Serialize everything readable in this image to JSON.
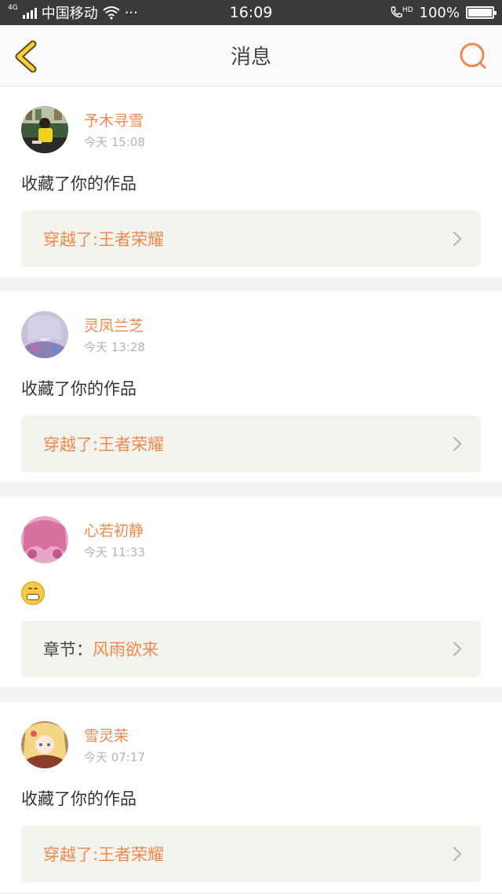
{
  "status_bar": {
    "network_type": "4G",
    "carrier": "中国移动",
    "more": "···",
    "time": "16:09",
    "call_badge": "HD",
    "battery": "100%",
    "battery_level": 1.0
  },
  "header": {
    "title": "消息",
    "back_icon": "chevron-left-icon",
    "search_icon": "search-icon",
    "accent": "#f0894d"
  },
  "messages": [
    {
      "username": "予木寻雪",
      "time": "今天 15:08",
      "text": "收藏了你的作品",
      "link_text": "穿越了:王者荣耀"
    },
    {
      "username": "灵凤兰芝",
      "time": "今天 13:28",
      "text": "收藏了你的作品",
      "link_text": "穿越了:王者荣耀"
    },
    {
      "username": "心若初静",
      "time": "今天 11:33",
      "emoji": "grinning-emoji",
      "link_prefix": "章节：",
      "link_text": "风雨欲来"
    },
    {
      "username": "雪灵茉",
      "time": "今天 07:17",
      "text": "收藏了你的作品",
      "link_text": "穿越了:王者荣耀"
    }
  ]
}
